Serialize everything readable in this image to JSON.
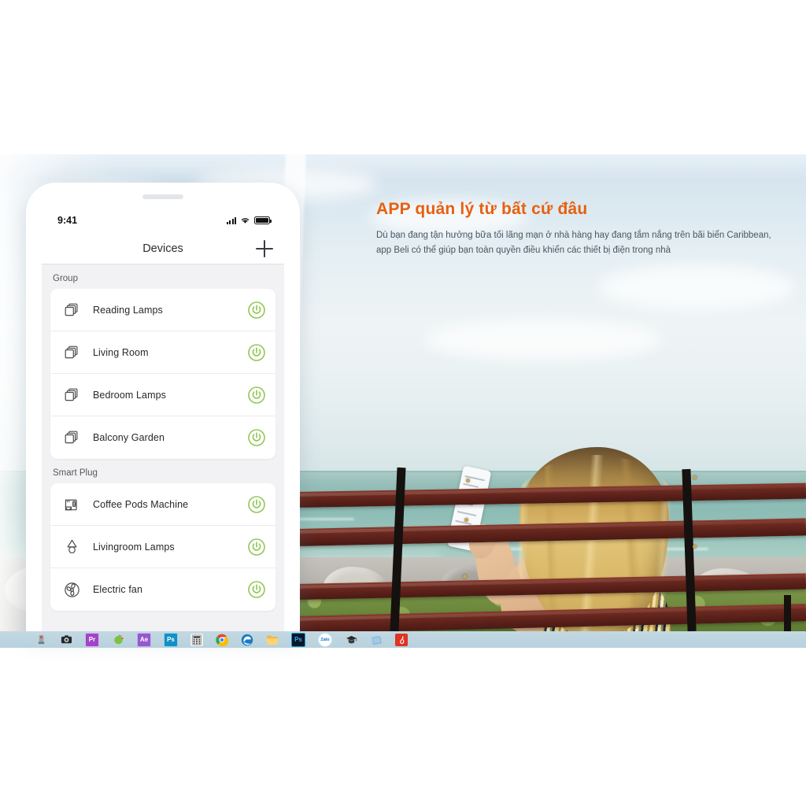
{
  "banner": {
    "heading": "APP quản lý từ bất cứ đâu",
    "paragraph": "Dù bạn đang tận hưởng bữa tối lãng mạn ở nhà hàng hay đang tắm nắng trên bãi biển Caribbean, app Beli có thể giúp bạn toàn quyền điều khiển các thiết bị điện trong nhà",
    "heading_color": "#e8600f",
    "paragraph_color": "#4a5560"
  },
  "phone": {
    "status": {
      "time": "9:41",
      "signal_icon": "signal-bars-icon",
      "wifi_icon": "wifi-icon",
      "battery_icon": "battery-full-icon"
    },
    "nav": {
      "title": "Devices",
      "add_icon": "plus-icon"
    },
    "sections": [
      {
        "title": "Group",
        "items": [
          {
            "label": "Reading Lamps",
            "icon": "stacked-squares-icon",
            "toggle_icon": "power-icon"
          },
          {
            "label": "Living Room",
            "icon": "stacked-squares-icon",
            "toggle_icon": "power-icon"
          },
          {
            "label": "Bedroom Lamps",
            "icon": "stacked-squares-icon",
            "toggle_icon": "power-icon"
          },
          {
            "label": "Balcony Garden",
            "icon": "stacked-squares-icon",
            "toggle_icon": "power-icon"
          }
        ]
      },
      {
        "title": "Smart Plug",
        "items": [
          {
            "label": "Coffee Pods Machine",
            "icon": "coffee-machine-icon",
            "toggle_icon": "power-icon"
          },
          {
            "label": "Livingroom Lamps",
            "icon": "table-lamp-icon",
            "toggle_icon": "power-icon"
          },
          {
            "label": "Electric fan",
            "icon": "fan-icon",
            "toggle_icon": "power-icon"
          }
        ]
      }
    ],
    "toggle_color": "#93c756"
  },
  "taskbar": {
    "items": [
      {
        "name": "usb-drive-icon",
        "label": "",
        "bg": "#8e9aa3"
      },
      {
        "name": "camera-icon",
        "label": "",
        "bg": "#2b2f33"
      },
      {
        "name": "adobe-premiere-icon",
        "label": "Pr",
        "bg": "#9b3bc4"
      },
      {
        "name": "colorful-app-icon",
        "label": "",
        "bg": "#8cc63e"
      },
      {
        "name": "adobe-aftereffects-icon",
        "label": "Ae",
        "bg": "#8f52c9"
      },
      {
        "name": "adobe-photoshop-icon",
        "label": "Ps",
        "bg": "#0f8fc0"
      },
      {
        "name": "calculator-icon",
        "label": "",
        "bg": "#ececec"
      },
      {
        "name": "google-chrome-icon",
        "label": "",
        "bg": "#ffffff"
      },
      {
        "name": "microsoft-edge-icon",
        "label": "e",
        "bg": "#ffffff"
      },
      {
        "name": "file-explorer-icon",
        "label": "",
        "bg": "#f2bf4a"
      },
      {
        "name": "adobe-photoshop-dark-icon",
        "label": "Ps",
        "bg": "#0d1c2b"
      },
      {
        "name": "zalo-icon",
        "label": "Zalo",
        "bg": "#ffffff"
      },
      {
        "name": "graduation-cap-icon",
        "label": "",
        "bg": "#2d2d2d"
      },
      {
        "name": "blue-folder-icon",
        "label": "",
        "bg": "#7fb6d6"
      },
      {
        "name": "red-app-icon",
        "label": "",
        "bg": "#e03322"
      }
    ]
  }
}
